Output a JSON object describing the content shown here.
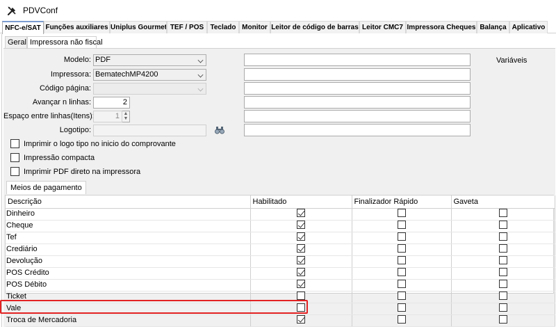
{
  "window": {
    "title": "PDVConf"
  },
  "main_tabs": [
    "NFC-e/SAT",
    "Funções auxiliares",
    "Uniplus Gourmet",
    "TEF / POS",
    "Teclado",
    "Monitor",
    "Leitor de código de barras",
    "Leitor CMC7",
    "Impressora Cheques",
    "Balança",
    "Aplicativo"
  ],
  "sub_tabs": [
    "Geral",
    "Impressora não fiscal"
  ],
  "form": {
    "modelo_label": "Modelo:",
    "modelo_value": "PDF",
    "impressora_label": "Impressora:",
    "impressora_value": "BematechMP4200",
    "codigo_pagina_label": "Código página:",
    "avancar_label": "Avançar n linhas:",
    "avancar_value": "2",
    "espaco_label": "Espaço entre linhas(Itens):",
    "espaco_value": "1",
    "logotipo_label": "Logotipo:",
    "variaveis_label": "Variáveis"
  },
  "options": [
    {
      "label": "Imprimir o logo tipo no inicio do comprovante",
      "checked": false
    },
    {
      "label": "Impressão compacta",
      "checked": false
    },
    {
      "label": "Imprimir PDF direto na impressora",
      "checked": false
    }
  ],
  "payments": {
    "tab_label": "Meios de pagamento",
    "columns": [
      "Descrição",
      "Habilitado",
      "Finalizador Rápido",
      "Gaveta"
    ],
    "rows": [
      {
        "descricao": "Dinheiro",
        "habilitado": true,
        "finalizador": false,
        "gaveta": false
      },
      {
        "descricao": "Cheque",
        "habilitado": true,
        "finalizador": false,
        "gaveta": false
      },
      {
        "descricao": "Tef",
        "habilitado": true,
        "finalizador": false,
        "gaveta": false
      },
      {
        "descricao": "Crediário",
        "habilitado": true,
        "finalizador": false,
        "gaveta": false
      },
      {
        "descricao": "Devolução",
        "habilitado": true,
        "finalizador": false,
        "gaveta": false
      },
      {
        "descricao": "POS Crédito",
        "habilitado": true,
        "finalizador": false,
        "gaveta": false
      },
      {
        "descricao": "POS Débito",
        "habilitado": true,
        "finalizador": false,
        "gaveta": false
      },
      {
        "descricao": "Ticket",
        "habilitado": false,
        "finalizador": false,
        "gaveta": false
      },
      {
        "descricao": "Vale",
        "habilitado": false,
        "finalizador": false,
        "gaveta": false
      },
      {
        "descricao": "Troca de Mercadoria",
        "habilitado": true,
        "finalizador": false,
        "gaveta": false
      }
    ]
  },
  "colors": {
    "highlight": "#e32222",
    "active_tab_accent": "#7a9cd0"
  }
}
